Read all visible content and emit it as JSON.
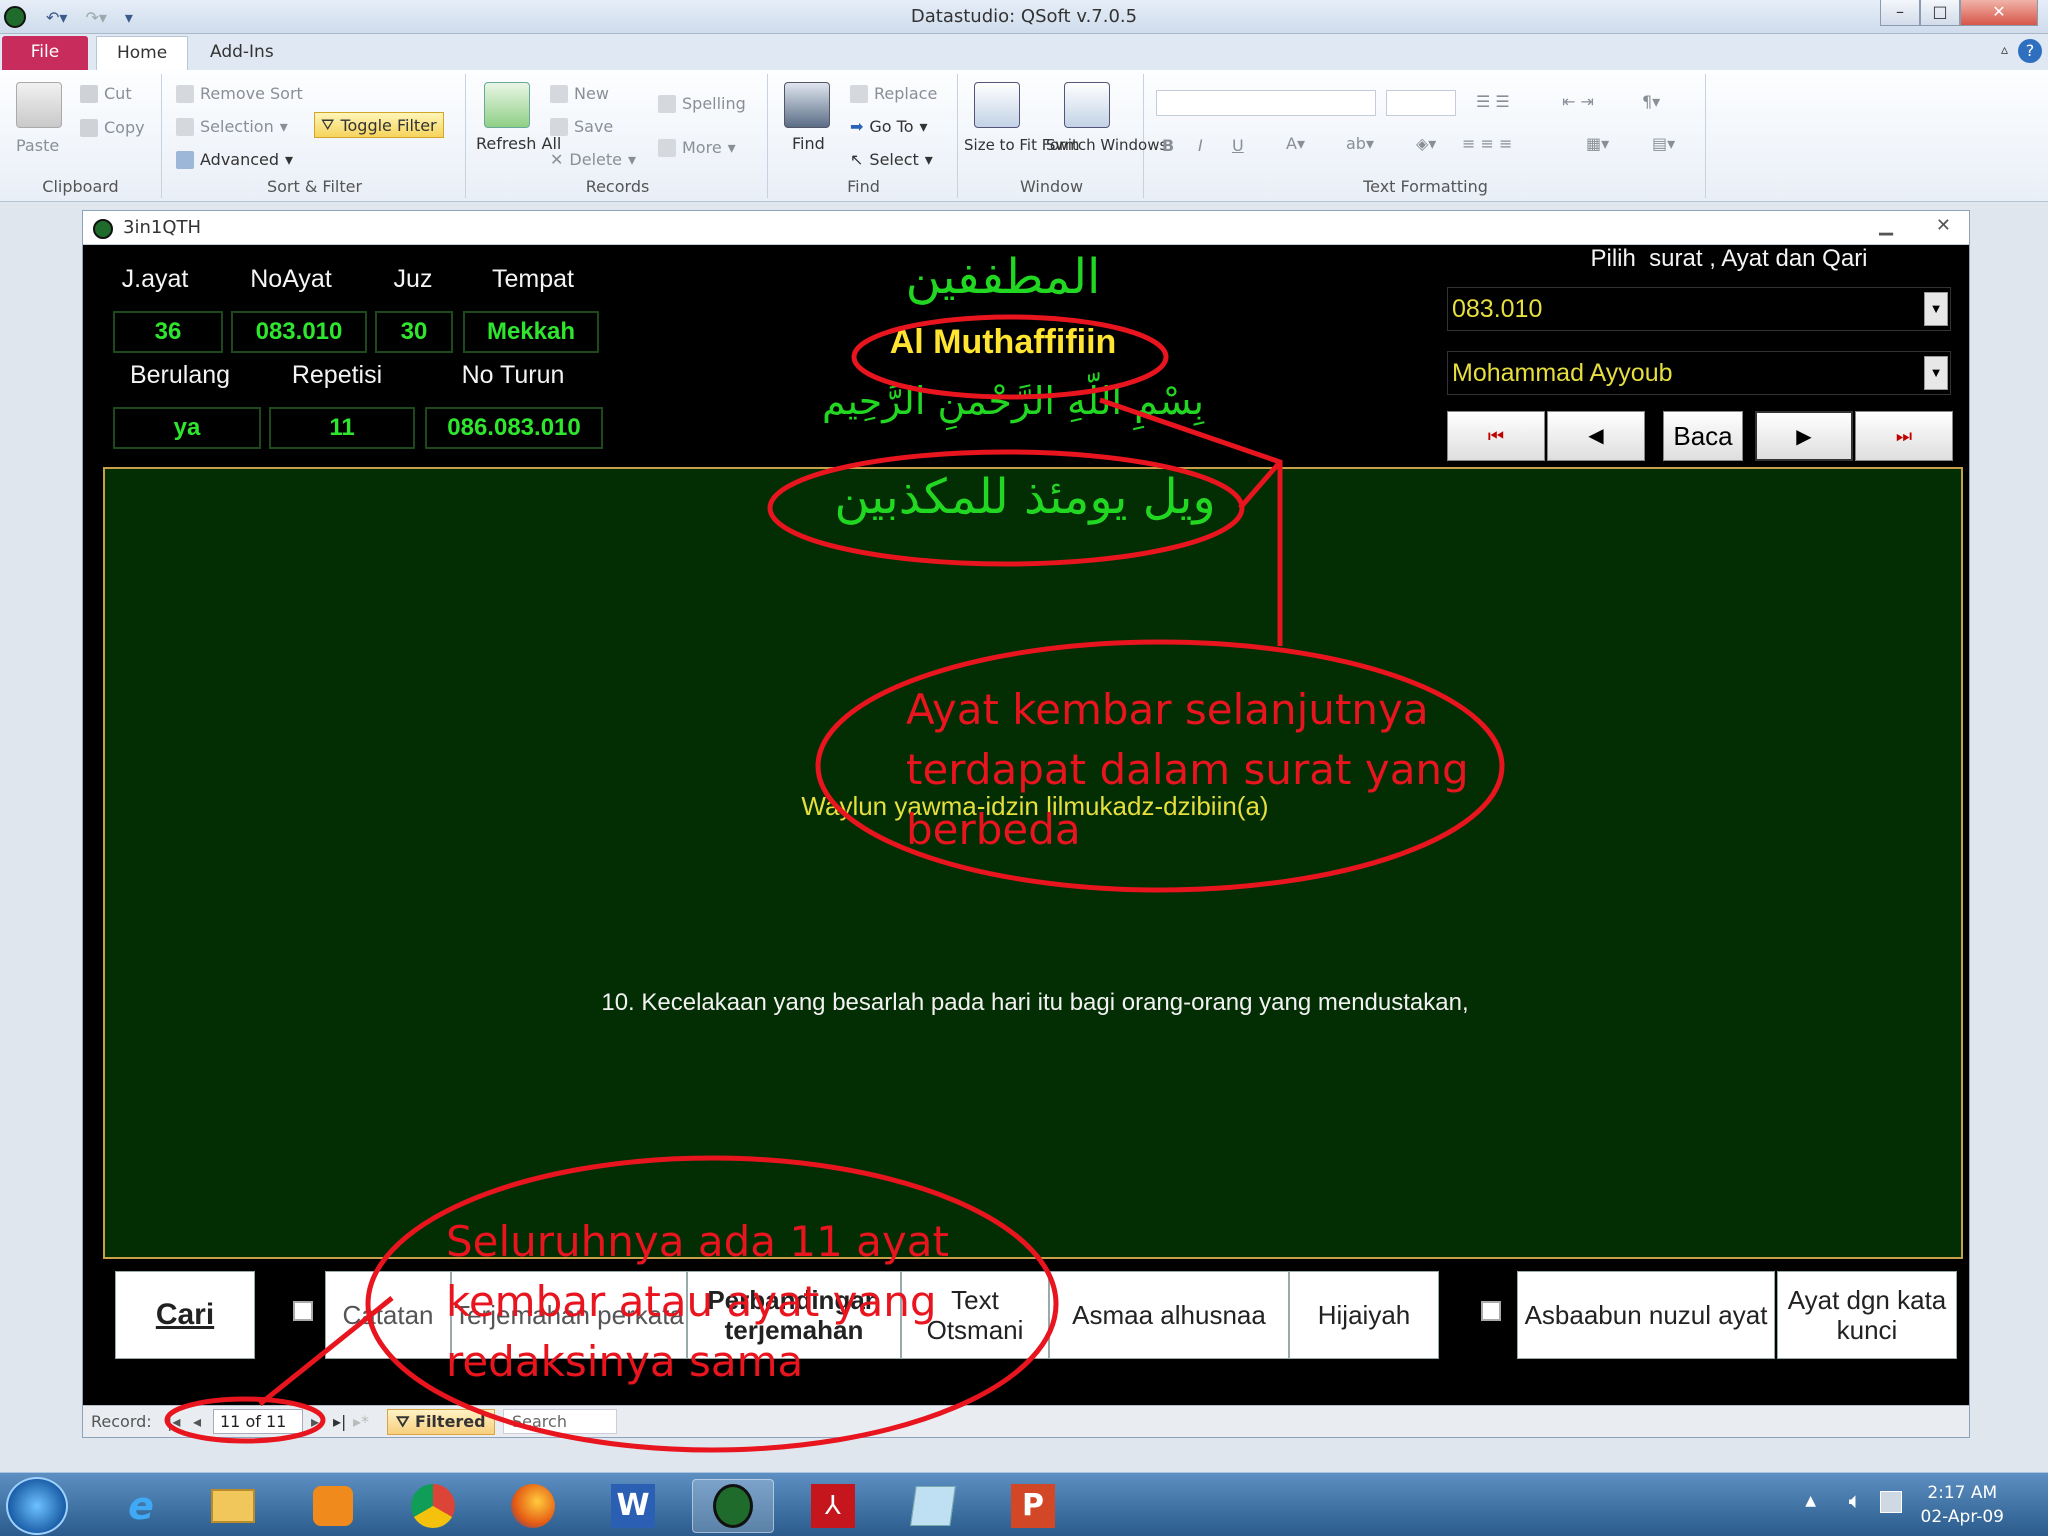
{
  "window": {
    "title": "Datastudio: QSoft v.7.0.5",
    "minimize": "–",
    "maximize": "□",
    "close": "✕"
  },
  "tabs": [
    "File",
    "Home",
    "Add-Ins"
  ],
  "ribbon": {
    "clipboard": {
      "label": "Clipboard",
      "paste": "Paste",
      "cut": "Cut",
      "copy": "Copy"
    },
    "sort_filter": {
      "label": "Sort & Filter",
      "remove_sort": "Remove Sort",
      "selection": "Selection",
      "advanced": "Advanced",
      "toggle_filter": "Toggle Filter"
    },
    "records": {
      "label": "Records",
      "refresh_all": "Refresh All",
      "new": "New",
      "save": "Save",
      "delete": "Delete",
      "spelling": "Spelling",
      "more": "More"
    },
    "find": {
      "label": "Find",
      "find": "Find",
      "replace": "Replace",
      "go_to": "Go To",
      "select": "Select"
    },
    "window": {
      "label": "Window",
      "size_to_fit": "Size to Fit Form",
      "switch_windows": "Switch Windows"
    },
    "text_formatting": {
      "label": "Text Formatting",
      "bold": "B",
      "italic": "I",
      "underline": "U"
    }
  },
  "form": {
    "title": "3in1QTH",
    "labels": {
      "jayat": "J.ayat",
      "noayat": "NoAyat",
      "juz": "Juz",
      "tempat": "Tempat",
      "berulang": "Berulang",
      "repetisi": "Repetisi",
      "no_turun": "No Turun"
    },
    "values": {
      "jayat": "36",
      "noayat": "083.010",
      "juz": "30",
      "tempat": "Mekkah",
      "berulang": "ya",
      "repetisi": "11",
      "no_turun": "086.083.010"
    },
    "surah_arabic": "المطففين",
    "surah_latin": "Al Muthaffifiin",
    "basmalah": "بِسْمِ اللّهِ الرَّحْمنِ الرَّحِيم",
    "picker_label": "Pilih  surat , Ayat dan Qari",
    "ayat_select": "083.010",
    "qari_select": "Mohammad Ayyoub",
    "nav": {
      "first": "⏮",
      "prev": "◀",
      "read": "Baca",
      "next": "▶",
      "last": "⏭"
    },
    "ayat_arabic": "ويل يومئذ للمكذبين",
    "transliteration": "Waylun yawma-idzin lilmukadz-dzibiin(a)",
    "translation": "10. Kecelakaan yang besarlah pada hari itu bagi orang-orang yang mendustakan,",
    "buttons": {
      "cari": "Cari",
      "catatan": "Catatan",
      "terjemahan_perkata": "Terjemahan perkata",
      "perbandingan": "Perbandingan terjemahan",
      "text_otsmani": "Text Otsmani",
      "asmaa": "Asmaa alhusnaa",
      "hijaiyah": "Hijaiyah",
      "asbaabun": "Asbaabun nuzul ayat",
      "ayat_kunci": "Ayat dgn kata kunci"
    },
    "record_bar": {
      "label": "Record:",
      "position": "11 of 11",
      "filtered": "Filtered",
      "search": "Search"
    }
  },
  "annotations": {
    "right": "Ayat kembar selanjutnya terdapat dalam surat yang berbeda",
    "bottom": "Seluruhnya ada 11 ayat kembar atau ayat yang redaksinya sama"
  },
  "taskbar": {
    "time": "2:17 AM",
    "date": "02-Apr-09"
  },
  "colors": {
    "accent_red": "#e8141e",
    "arabic_green": "#22d722",
    "surah_yellow": "#ffe531",
    "panel_green": "#032d02",
    "file_tab": "#c72c5d"
  }
}
